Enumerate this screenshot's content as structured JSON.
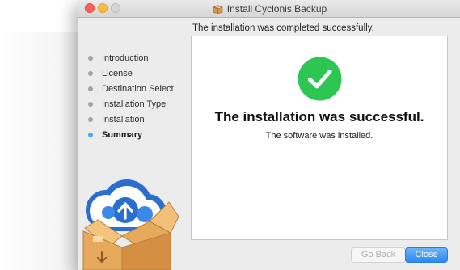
{
  "window": {
    "title": "Install Cyclonis Backup",
    "title_icon": "package-icon"
  },
  "header": {
    "message": "The installation was completed successfully."
  },
  "sidebar": {
    "steps": [
      {
        "label": "Introduction"
      },
      {
        "label": "License"
      },
      {
        "label": "Destination Select"
      },
      {
        "label": "Installation Type"
      },
      {
        "label": "Installation"
      },
      {
        "label": "Summary"
      }
    ],
    "active_step": "Summary"
  },
  "main": {
    "status_icon": "checkmark-icon",
    "headline": "The installation was successful.",
    "subtext": "The software was installed."
  },
  "buttons": {
    "back_label": "Go Back",
    "close_label": "Close"
  },
  "colors": {
    "success_green": "#2dc653",
    "accent_blue": "#2c89f0",
    "active_dot": "#55a4e7"
  }
}
